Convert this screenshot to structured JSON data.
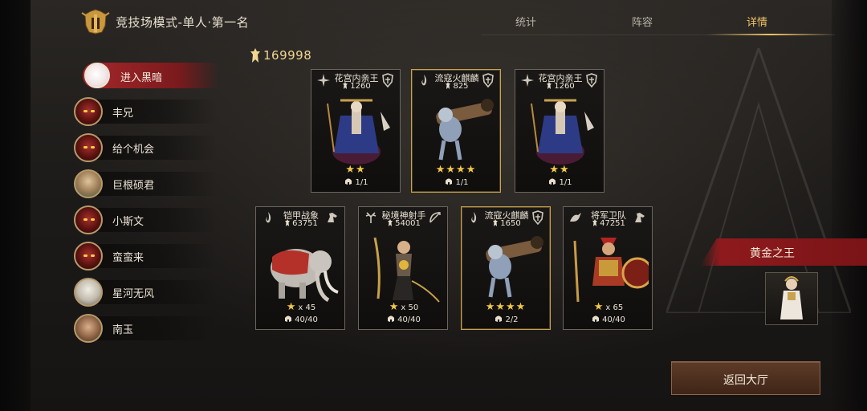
{
  "header": {
    "title": "竞技场模式-单人·第一名",
    "tabs": [
      {
        "label": "统计",
        "active": false
      },
      {
        "label": "阵容",
        "active": false
      },
      {
        "label": "详情",
        "active": true
      }
    ]
  },
  "power": "169998",
  "sidebar": {
    "enter_dark": "进入黑暗",
    "players": [
      {
        "name": "丰兄",
        "avatar": "demon-helm-avatar"
      },
      {
        "name": "给个机会",
        "avatar": "demon-helm-avatar"
      },
      {
        "name": "巨根硕君",
        "avatar": "dwarf-avatar"
      },
      {
        "name": "小斯文",
        "avatar": "demon-helm-avatar"
      },
      {
        "name": "蛮蛮来",
        "avatar": "demon-helm-avatar"
      },
      {
        "name": "星河无风",
        "avatar": "elf-avatar"
      },
      {
        "name": "南玉",
        "avatar": "human-avatar"
      }
    ]
  },
  "cards_top": [
    {
      "name": "花宫内亲王",
      "power": "1260",
      "stars": "★★",
      "multiplier": "",
      "count": "1/1",
      "gold": false,
      "type_icon": "magic-icon",
      "class_icon": "crest-icon"
    },
    {
      "name": "流寇火麒麟",
      "power": "825",
      "stars": "★★★★",
      "multiplier": "",
      "count": "1/1",
      "gold": true,
      "type_icon": "fire-icon",
      "class_icon": "crest-icon"
    },
    {
      "name": "花宫内亲王",
      "power": "1260",
      "stars": "★★",
      "multiplier": "",
      "count": "1/1",
      "gold": false,
      "type_icon": "magic-icon",
      "class_icon": "crest-icon"
    }
  ],
  "cards_bottom": [
    {
      "name": "铠甲战象",
      "power": "63751",
      "stars": "★",
      "multiplier": "x 45",
      "count": "40/40",
      "gold": false,
      "type_icon": "fire-icon",
      "class_icon": "horse-icon"
    },
    {
      "name": "秘境神射手",
      "power": "54001",
      "stars": "★",
      "multiplier": "x 50",
      "count": "40/40",
      "gold": false,
      "type_icon": "antler-icon",
      "class_icon": "bow-icon"
    },
    {
      "name": "流寇火麒麟",
      "power": "1650",
      "stars": "★★★★",
      "multiplier": "",
      "count": "2/2",
      "gold": true,
      "type_icon": "fire-icon",
      "class_icon": "crest-icon"
    },
    {
      "name": "将军卫队",
      "power": "47251",
      "stars": "★",
      "multiplier": "x 65",
      "count": "40/40",
      "gold": false,
      "type_icon": "dragon-icon",
      "class_icon": "horse-icon"
    }
  ],
  "golden_king": {
    "label": "黄金之王"
  },
  "back_button": {
    "label": "返回大厅"
  },
  "colors": {
    "accent_gold": "#f2c46a",
    "banner_red": "#8e1a1d",
    "star": "#f3c64a"
  }
}
